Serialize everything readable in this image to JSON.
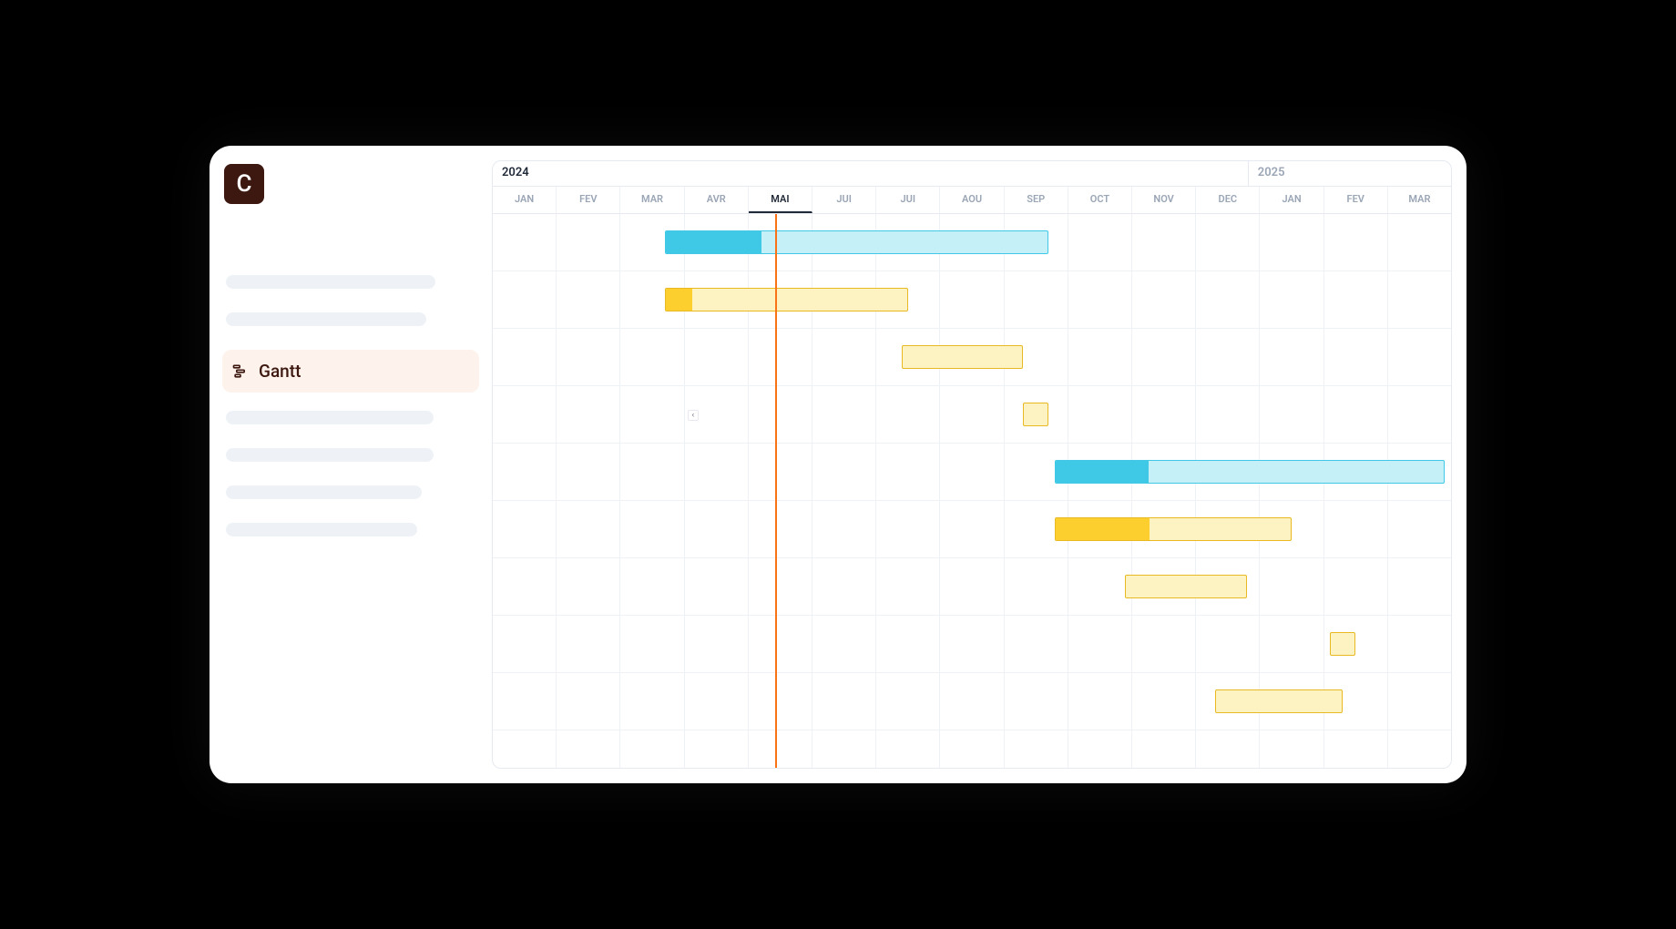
{
  "logo": {
    "letter": "C"
  },
  "sidebar": {
    "active_label": "Gantt"
  },
  "timeline": {
    "years": [
      {
        "label": "2024",
        "span": 12
      },
      {
        "label": "2025",
        "span": 3
      }
    ],
    "months": [
      "JAN",
      "FEV",
      "MAR",
      "AVR",
      "MAI",
      "JUI",
      "JUI",
      "AOU",
      "SEP",
      "OCT",
      "NOV",
      "DEC",
      "JAN",
      "FEV",
      "MAR"
    ],
    "current_month_index": 4,
    "today_position_pct": 29.5
  },
  "chart_data": {
    "type": "gantt",
    "time_axis": {
      "start": "2024-01",
      "end": "2025-03",
      "unit": "month"
    },
    "rows": [
      {
        "color": "blue",
        "start_month": 2.7,
        "end_month": 8.7,
        "progress_pct": 25
      },
      {
        "color": "yellow",
        "start_month": 2.7,
        "end_month": 6.5,
        "progress_pct": 11
      },
      {
        "color": "yellow",
        "start_month": 6.4,
        "end_month": 8.3,
        "progress_pct": 0
      },
      {
        "color": "yellow",
        "start_month": 8.3,
        "end_month": 8.7,
        "progress_pct": 0
      },
      {
        "color": "blue",
        "start_month": 8.8,
        "end_month": 14.9,
        "progress_pct": 24
      },
      {
        "color": "yellow",
        "start_month": 8.8,
        "end_month": 12.5,
        "progress_pct": 40
      },
      {
        "color": "yellow",
        "start_month": 9.9,
        "end_month": 11.8,
        "progress_pct": 0
      },
      {
        "color": "yellow",
        "start_month": 13.1,
        "end_month": 13.5,
        "progress_pct": 0
      },
      {
        "color": "yellow",
        "start_month": 11.3,
        "end_month": 13.3,
        "progress_pct": 0
      }
    ]
  }
}
